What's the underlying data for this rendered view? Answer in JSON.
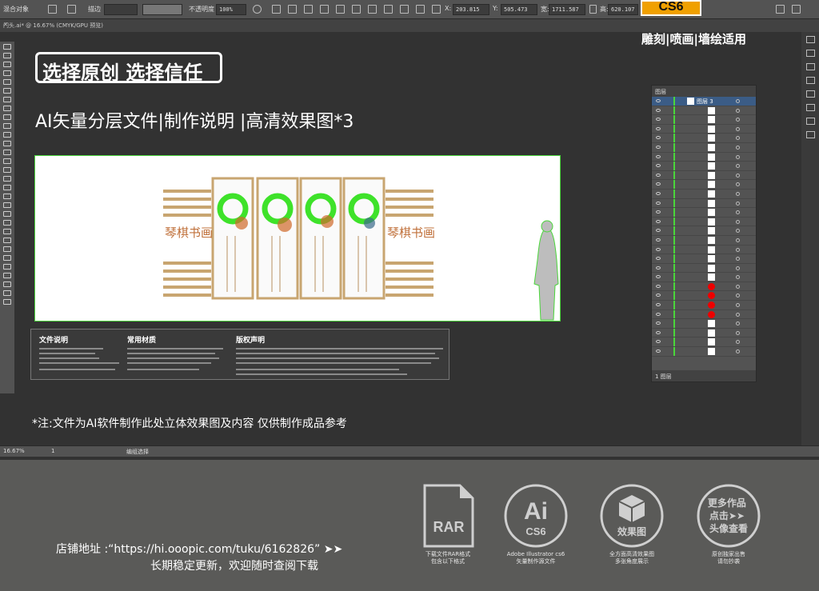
{
  "control_bar": {
    "selection_label": "混合对象",
    "stroke_label": "描边",
    "opacity_label": "不透明度",
    "opacity_value": "100%",
    "x_label": "X:",
    "x_value": "203.815",
    "y_label": "Y:",
    "y_value": "505.473",
    "w_label": "宽:",
    "w_value": "1711.587",
    "h_label": "高:",
    "h_value": "620.107",
    "version_badge": "CS6"
  },
  "document_tab": {
    "title": "门头.ai* @ 16.67% (CMYK/GPU 预览)"
  },
  "canvas": {
    "headline": "选择原创 选择信任",
    "subtitle": "AI矢量分层文件|制作说明 |高清效果图*3",
    "art_left_label": "琴棋书画",
    "art_right_label": "琴棋书画",
    "info_panel": {
      "col1_title": "文件说明",
      "col2_title": "常用材质",
      "col3_title": "版权声明"
    },
    "note": "*注:文件为AI软件制作此处立体效果图及内容 仅供制作成品参考",
    "usage": "雕刻|喷画|墙绘适用"
  },
  "layers_panel": {
    "tab_title": "图层",
    "top_layer_name": "图层 3",
    "footer_label": "1 图层",
    "row_count": 28
  },
  "status_bar": {
    "zoom": "16.67%",
    "page": "1",
    "tool": "编组选择"
  },
  "promo": {
    "store_address": "店铺地址 :“https://hi.ooopic.com/tuku/6162826” ➤➤",
    "update_note": "长期稳定更新，欢迎随时查阅下载",
    "badges": [
      {
        "icon": "RAR",
        "caption1": "下载文件RAR格式",
        "caption2": "包含以下格式"
      },
      {
        "icon": "Ai",
        "icon_sub": "CS6",
        "caption1": "Adobe Illustrator cs6",
        "caption2": "矢量制作源文件"
      },
      {
        "icon": "效果图",
        "caption1": "全方面高清效果图",
        "caption2": "多张角度展示"
      },
      {
        "icon": "更多作品\n点击➤➤\n头像查看",
        "caption1": "原创独家出售",
        "caption2": "请勿抄袭"
      }
    ]
  },
  "colors": {
    "accent_green": "#4ad63a",
    "badge_orange": "#f0a000",
    "app_bg": "#323232"
  }
}
